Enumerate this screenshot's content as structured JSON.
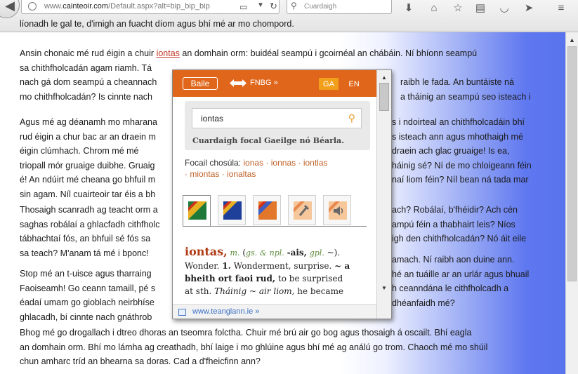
{
  "browser": {
    "url_prefix": "www.",
    "url_domain": "cainteoir.com",
    "url_path": "/Default.aspx?alt=bip_bip_bip",
    "search_placeholder": "Cuardaigh",
    "icons": [
      "back-arrow-icon",
      "globe-icon",
      "reader-view-icon",
      "dropdown-icon",
      "reload-icon",
      "search-icon",
      "download-icon",
      "home-icon",
      "bookmark-star-icon",
      "bookmarks-list-icon",
      "pocket-icon",
      "send-icon",
      "menu-icon"
    ]
  },
  "article": {
    "p1": [
      "líonadh le gal te, d'imigh an fuacht díom agus bhí mé ar mo chompord."
    ],
    "p2": [
      {
        "pre": "Ansin chonaic mé rud éigin a chuir ",
        "hl": "iontas",
        "post": " an domhain orm: buidéal seampú i gcoirnéal an chábáin. Ní bhíonn seampú"
      },
      {
        "pre": "sa chithfholcadán agam riamh. Tá",
        "hl": "",
        "post": ""
      },
      {
        "pre": "nach gá dom seampú a cheannach",
        "hl": "",
        "post": ""
      },
      {
        "pre": "mo chithfholcadán? Is cinnte nach",
        "hl": "",
        "post": ""
      }
    ],
    "p2_right": [
      "raibh le fada. An buntáiste ná",
      "a tháinig an seampú seo isteach i"
    ],
    "p3": [
      "Agus mé ag déanamh mo mharana",
      "rud éigin a chur bac ar an draein m",
      "éigin clúmhach. Chrom mé mé",
      "triopall mór gruaige duibhe. Gruaig",
      "é! An ndúirt mé cheana go bhfuil m",
      "sin agam. Níl cuairteoir tar éis a bh"
    ],
    "p3_right": [
      "s i ndoirteal an chithfholcadáin bhí",
      "s isteach ann agus mhothaigh mé",
      "draein ach glac gruaige! Is ea,",
      "háinig sé? Ní de mo chloigeann féin",
      "naí liom féin? Níl bean ná tada mar"
    ],
    "p4": [
      "Thosaigh scanradh ag teacht orm a",
      "saghas robálaí a ghlacfadh cithfholc",
      "tábhachtaí fós, an bhfuil sé fós sa",
      "sa teach? M'anam tá mé i bponc!"
    ],
    "p4_right": [
      "ach? Robálaí, b'fhéidir? Ach cén",
      "ampú féin a thabhairt leis? Níos",
      "igh den chithfholcadán? Nó áit eile"
    ],
    "p5": [
      "Stop mé an t-uisce agus tharraing",
      "Faoiseamh! Go ceann tamaill, pé s",
      "éadaí umam go gioblach neirbhíse",
      "ghlacadh, bí cinnte nach gnáthrob"
    ],
    "p5_right": [
      "amach. Ní raibh aon duine ann.",
      "hé an tuáille ar an urlár agus bhuail",
      "h ceanndána le cithfholcadh a",
      "dhéanfaidh mé?"
    ],
    "p6": [
      "Bhog mé go drogallach i dtreo dhoras an tseomra folctha. Chuir mé brú air go bog agus thosaigh á oscailt. Bhí eagla",
      "an domhain orm. Bhí mo lámha ag creathadh, bhí laige i mo ghlúine agus bhí mé ag análú go trom. Chaoch mé mo shúil",
      "chun amharc tríd an bhearna sa doras. Cad a d'fheicfinn ann?"
    ]
  },
  "popup": {
    "home_label": "Baile",
    "fnbg_label": "FNBG »",
    "lang_ga": "GA",
    "lang_en": "EN",
    "search_value": "iontas",
    "search_hint": "Cuardaigh focal Gaeilge nó Béarla.",
    "similar_label": "Focail chosúla:",
    "similar_words": [
      "ionas",
      "ionnas",
      "iontlas",
      "miontas",
      "ionaltas"
    ],
    "tabs": [
      "dictionary-fgb-icon",
      "dictionary-eid-icon",
      "dictionary-focloir-icon",
      "grammar-tools-icon",
      "pronunciation-speaker-icon"
    ],
    "entry": {
      "headword": "iontas,",
      "gender": "m.",
      "gram_open": "(",
      "gram1": "gs.",
      "gram_amp": "&",
      "gram2": "npl.",
      "ending": "-ais,",
      "gpl": "gpl.",
      "gram_close": "~).",
      "line2_a": "Wonder.",
      "sense1": "1.",
      "line2_b": "Wonderment, surprise.",
      "tilde": "~ a",
      "line3_bold": "bheith ort faoi rud,",
      "line3_rest": "to be surprised",
      "line4_a": "at sth.",
      "line4_ex": "Tháinig ~ air liom,",
      "line4_b": "he became"
    },
    "footer_link": "www.teanglann.ie »"
  }
}
